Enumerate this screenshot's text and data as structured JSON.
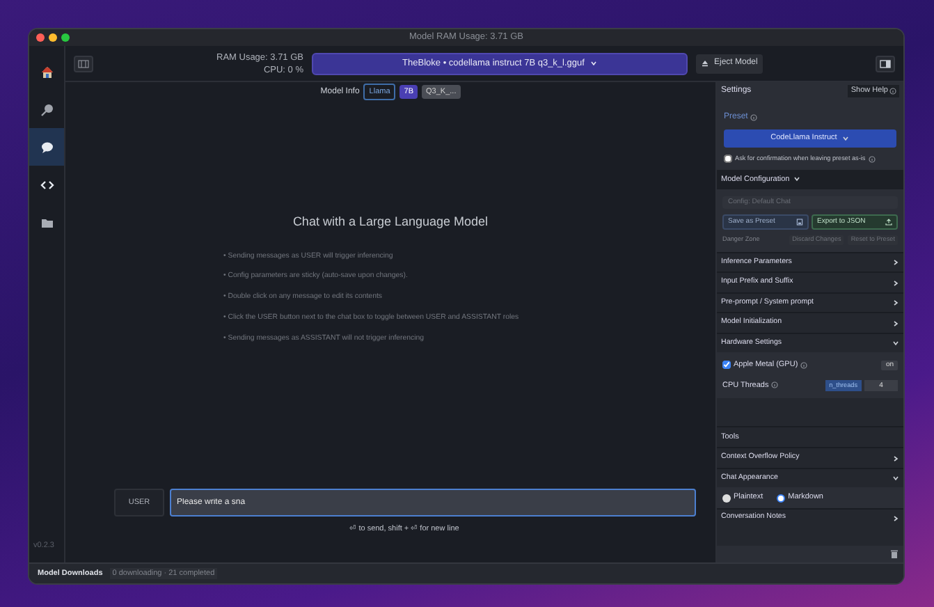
{
  "window": {
    "title": "Model RAM Usage: 3.71 GB"
  },
  "nav_rail": {
    "items": [
      {
        "kind": "home",
        "selected": false
      },
      {
        "kind": "search",
        "selected": false
      },
      {
        "kind": "chat",
        "selected": true
      },
      {
        "kind": "arrows",
        "selected": false
      },
      {
        "kind": "folder",
        "selected": false
      }
    ],
    "version": "v0.2.3"
  },
  "toolbar": {
    "ram_usage": "RAM Usage: 3.71 GB",
    "cpu": "CPU: 0 %",
    "model_selector": "TheBloke • codellama instruct 7B q3_k_l.gguf",
    "eject_button": "Eject Model"
  },
  "model_info": {
    "label": "Model Info",
    "tags": [
      "Llama",
      "7B",
      "Q3_K_..."
    ]
  },
  "chat": {
    "heading": "Chat with a Large Language Model",
    "tips": [
      "• Sending messages as USER will trigger inferencing",
      "• Config parameters are sticky (auto-save upon changes).",
      "• Double click on any message to edit its contents",
      "• Click the USER button next to the chat box to toggle between USER and ASSISTANT roles",
      "• Sending messages as ASSISTANT will not trigger inferencing"
    ],
    "role_button": "USER",
    "input": {
      "value": "Please write a sna"
    },
    "hint": "⏎ to send, shift + ⏎ for new line"
  },
  "settings": {
    "title": "Settings",
    "help_button": "Show Help",
    "preset_label": "Preset",
    "preset": "CodeLlama Instruct",
    "confirm": {
      "label": "Ask for confirmation when leaving preset as-is",
      "checked": false
    },
    "model_configuration": {
      "title": "Model Configuration",
      "expanded": true,
      "config_name": "Config: Default Chat",
      "buttons": [
        "Save as Preset",
        "Export to JSON"
      ],
      "danger_zone": "Danger Zone",
      "danger_buttons": [
        "Discard Changes",
        "Reset to Preset"
      ]
    },
    "sections": [
      {
        "title": "Inference Parameters",
        "expanded": false
      },
      {
        "title": "Input Prefix and Suffix",
        "expanded": false
      },
      {
        "title": "Pre-prompt / System prompt",
        "expanded": false
      },
      {
        "title": "Model Initialization",
        "expanded": false
      },
      {
        "title": "Hardware Settings",
        "expanded": true,
        "gpu": {
          "label": "Apple Metal (GPU)",
          "checked": true,
          "value": "on"
        },
        "threads": {
          "label": "CPU Threads",
          "param": "n_threads",
          "value": "4"
        }
      }
    ],
    "tools_title": "Tools",
    "tool_sections": [
      {
        "title": "Context Overflow Policy",
        "expanded": false
      },
      {
        "title": "Chat Appearance",
        "expanded": true,
        "options": [
          {
            "label": "Plaintext",
            "selected": false
          },
          {
            "label": "Markdown",
            "selected": true
          }
        ]
      },
      {
        "title": "Conversation Notes",
        "expanded": false
      }
    ]
  },
  "status_bar": {
    "label": "Model Downloads",
    "status": "0 downloading · 21 completed"
  }
}
